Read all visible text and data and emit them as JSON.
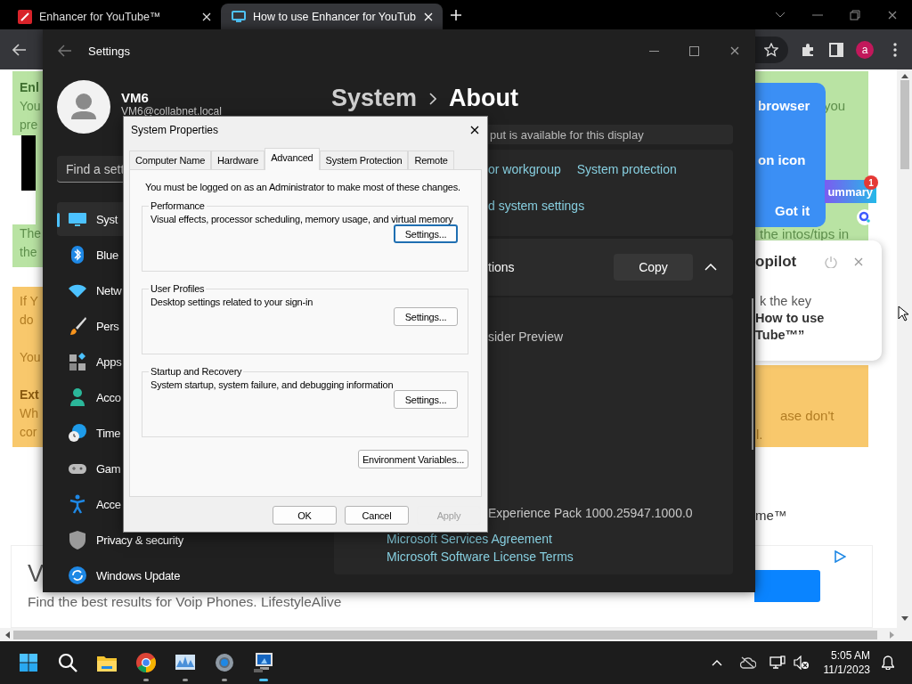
{
  "browser": {
    "tabs": [
      {
        "title": "Enhancer for YouTube™",
        "selected": false
      },
      {
        "title": "How to use Enhancer for YouTub",
        "selected": true
      }
    ],
    "profile_letter": "a"
  },
  "webpage": {
    "left_notes": [
      {
        "kind": "tip",
        "blocks": [
          {
            "kind": "text",
            "lines": [
              {
                "text": "Enl",
                "bold": true
              },
              {
                "text": "You",
                "bold": false
              },
              {
                "text": "pre",
                "bold": false
              }
            ]
          },
          {
            "kind": "picture"
          },
          {
            "kind": "text",
            "lines": [
              {
                "text": "The",
                "bold": false
              },
              {
                "text": "the",
                "bold": false
              }
            ]
          }
        ]
      },
      {
        "kind": "warning",
        "blocks": [
          {
            "kind": "text",
            "lines": [
              {
                "text": "If Y",
                "bold": false
              },
              {
                "text": "do",
                "bold": false
              }
            ]
          },
          {
            "kind": "text",
            "lines": [
              {
                "text": "You",
                "bold": false
              }
            ]
          },
          {
            "kind": "text",
            "lines": [
              {
                "text": "Ext",
                "bold": true
              },
              {
                "text": "Wh",
                "bold": false
              },
              {
                "text": "cor",
                "bold": false
              }
            ]
          }
        ]
      }
    ],
    "right_tip": {
      "lines": [
        "you",
        "the intos/tips in"
      ]
    },
    "tooltip": {
      "lines": [
        "browser",
        "on icon"
      ],
      "button": "Got it"
    },
    "summary_badge": {
      "label": "ummary",
      "count": "1"
    },
    "copilot_card": {
      "title": "opilot",
      "lines": [
        {
          "text": "k the key",
          "bold": false
        },
        {
          "text": "How to use",
          "bold": true
        },
        {
          "text": "Tube™”",
          "bold": true
        }
      ]
    },
    "right_warning": {
      "lines": [
        "ase don't",
        "l."
      ]
    },
    "right_text": "me™",
    "ad": {
      "headline": "V",
      "description": "Find the best results for Voip Phones. LifestyleAlive"
    }
  },
  "settings": {
    "title": "Settings",
    "user": {
      "name": "VM6",
      "email": "VM6@collabnet.local"
    },
    "search": {
      "placeholder": "Find a sett"
    },
    "nav": [
      {
        "label": "Syst",
        "selected": true
      },
      {
        "label": "Blue",
        "selected": false
      },
      {
        "label": "Netw",
        "selected": false
      },
      {
        "label": "Pers",
        "selected": false
      },
      {
        "label": "Apps",
        "selected": false
      },
      {
        "label": "Acco",
        "selected": false
      },
      {
        "label": "Time",
        "selected": false
      },
      {
        "label": "Gam",
        "selected": false
      },
      {
        "label": "Acce",
        "selected": false
      },
      {
        "label": "Privacy & security",
        "selected": false
      },
      {
        "label": "Windows Update",
        "selected": false
      }
    ],
    "breadcrumb": [
      "System",
      "About"
    ],
    "display_note": "put is available for this display",
    "related_links": [
      "or workgroup",
      "System protection",
      "d system settings"
    ],
    "specs": {
      "label": "tions",
      "copy_button": "Copy",
      "expanded": true
    },
    "windows_specs": {
      "edition": "sider Preview",
      "experience": "Experience Pack 1000.25947.1000.0",
      "links": [
        "Microsoft Services Agreement",
        "Microsoft Software License Terms"
      ]
    }
  },
  "dialog": {
    "title": "System Properties",
    "tabs": [
      {
        "label": "Computer Name",
        "selected": false
      },
      {
        "label": "Hardware",
        "selected": false
      },
      {
        "label": "Advanced",
        "selected": true
      },
      {
        "label": "System Protection",
        "selected": false
      },
      {
        "label": "Remote",
        "selected": false
      }
    ],
    "notice": "You must be logged on as an Administrator to make most of these changes.",
    "groups": [
      {
        "title": "Performance",
        "description": "Visual effects, processor scheduling, memory usage, and virtual memory",
        "button": "Settings...",
        "focused": true
      },
      {
        "title": "User Profiles",
        "description": "Desktop settings related to your sign-in",
        "button": "Settings...",
        "focused": false
      },
      {
        "title": "Startup and Recovery",
        "description": "System startup, system failure, and debugging information",
        "button": "Settings...",
        "focused": false
      }
    ],
    "env_button": "Environment Variables...",
    "buttons": [
      {
        "label": "OK",
        "disabled": false
      },
      {
        "label": "Cancel",
        "disabled": false
      },
      {
        "label": "Apply",
        "disabled": true
      }
    ]
  },
  "taskbar": {
    "apps": [
      {
        "kind": "start",
        "running": false,
        "active": false
      },
      {
        "kind": "search",
        "running": false,
        "active": false
      },
      {
        "kind": "files",
        "running": false,
        "active": false
      },
      {
        "kind": "browser",
        "running": true,
        "active": false
      },
      {
        "kind": "monitor",
        "running": true,
        "active": false
      },
      {
        "kind": "settings",
        "running": true,
        "active": false
      },
      {
        "kind": "system",
        "running": true,
        "active": true
      }
    ],
    "time": "5:05 AM",
    "date": "11/1/2023"
  }
}
